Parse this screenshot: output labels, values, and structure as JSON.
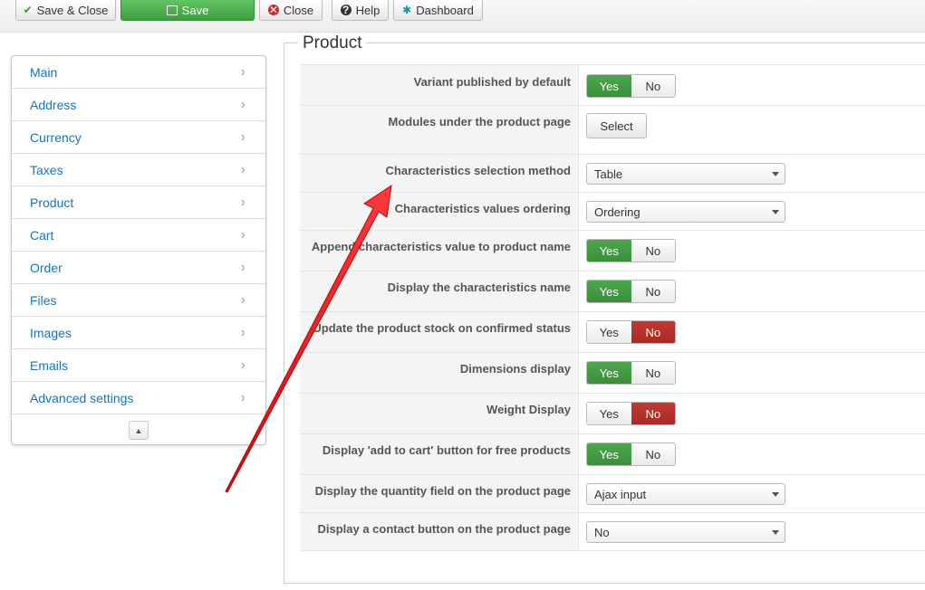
{
  "toolbar": {
    "save_close": "Save & Close",
    "save": "Save",
    "close": "Close",
    "help": "Help",
    "dashboard": "Dashboard"
  },
  "sidebar": {
    "items": [
      {
        "label": "Main"
      },
      {
        "label": "Address"
      },
      {
        "label": "Currency"
      },
      {
        "label": "Taxes"
      },
      {
        "label": "Product"
      },
      {
        "label": "Cart"
      },
      {
        "label": "Order"
      },
      {
        "label": "Files"
      },
      {
        "label": "Images"
      },
      {
        "label": "Emails"
      },
      {
        "label": "Advanced settings"
      }
    ]
  },
  "section": {
    "title": "Product"
  },
  "fields": [
    {
      "label": "Variant published by default",
      "type": "yesno",
      "value": "Yes"
    },
    {
      "label": "Modules under the product page",
      "type": "button",
      "value": "Select"
    },
    {
      "label": "Characteristics selection method",
      "type": "select",
      "value": "Table"
    },
    {
      "label": "Characteristics values ordering",
      "type": "select",
      "value": "Ordering"
    },
    {
      "label": "Append characteristics value to product name",
      "type": "yesno",
      "value": "Yes"
    },
    {
      "label": "Display the characteristics name",
      "type": "yesno",
      "value": "Yes"
    },
    {
      "label": "Update the product stock on confirmed status",
      "type": "yesno",
      "value": "No"
    },
    {
      "label": "Dimensions display",
      "type": "yesno",
      "value": "Yes"
    },
    {
      "label": "Weight Display",
      "type": "yesno",
      "value": "No"
    },
    {
      "label": "Display 'add to cart' button for free products",
      "type": "yesno",
      "value": "Yes"
    },
    {
      "label": "Display the quantity field on the product page",
      "type": "select",
      "value": "Ajax input"
    },
    {
      "label": "Display a contact button on the product page",
      "type": "select",
      "value": "No"
    }
  ],
  "yesno_labels": {
    "yes": "Yes",
    "no": "No"
  },
  "colors": {
    "yes_active": "#47a047",
    "no_active": "#b8332e",
    "link": "#1a72b5",
    "annotation_arrow": "#e3141a"
  },
  "icons": {
    "save_close": "check-icon",
    "save": "edit-icon",
    "close": "close-icon",
    "help": "help-icon",
    "dashboard": "dashboard-icon",
    "sidebar_chevron": "chevron-right-icon",
    "collapse": "collapse-up-icon"
  }
}
